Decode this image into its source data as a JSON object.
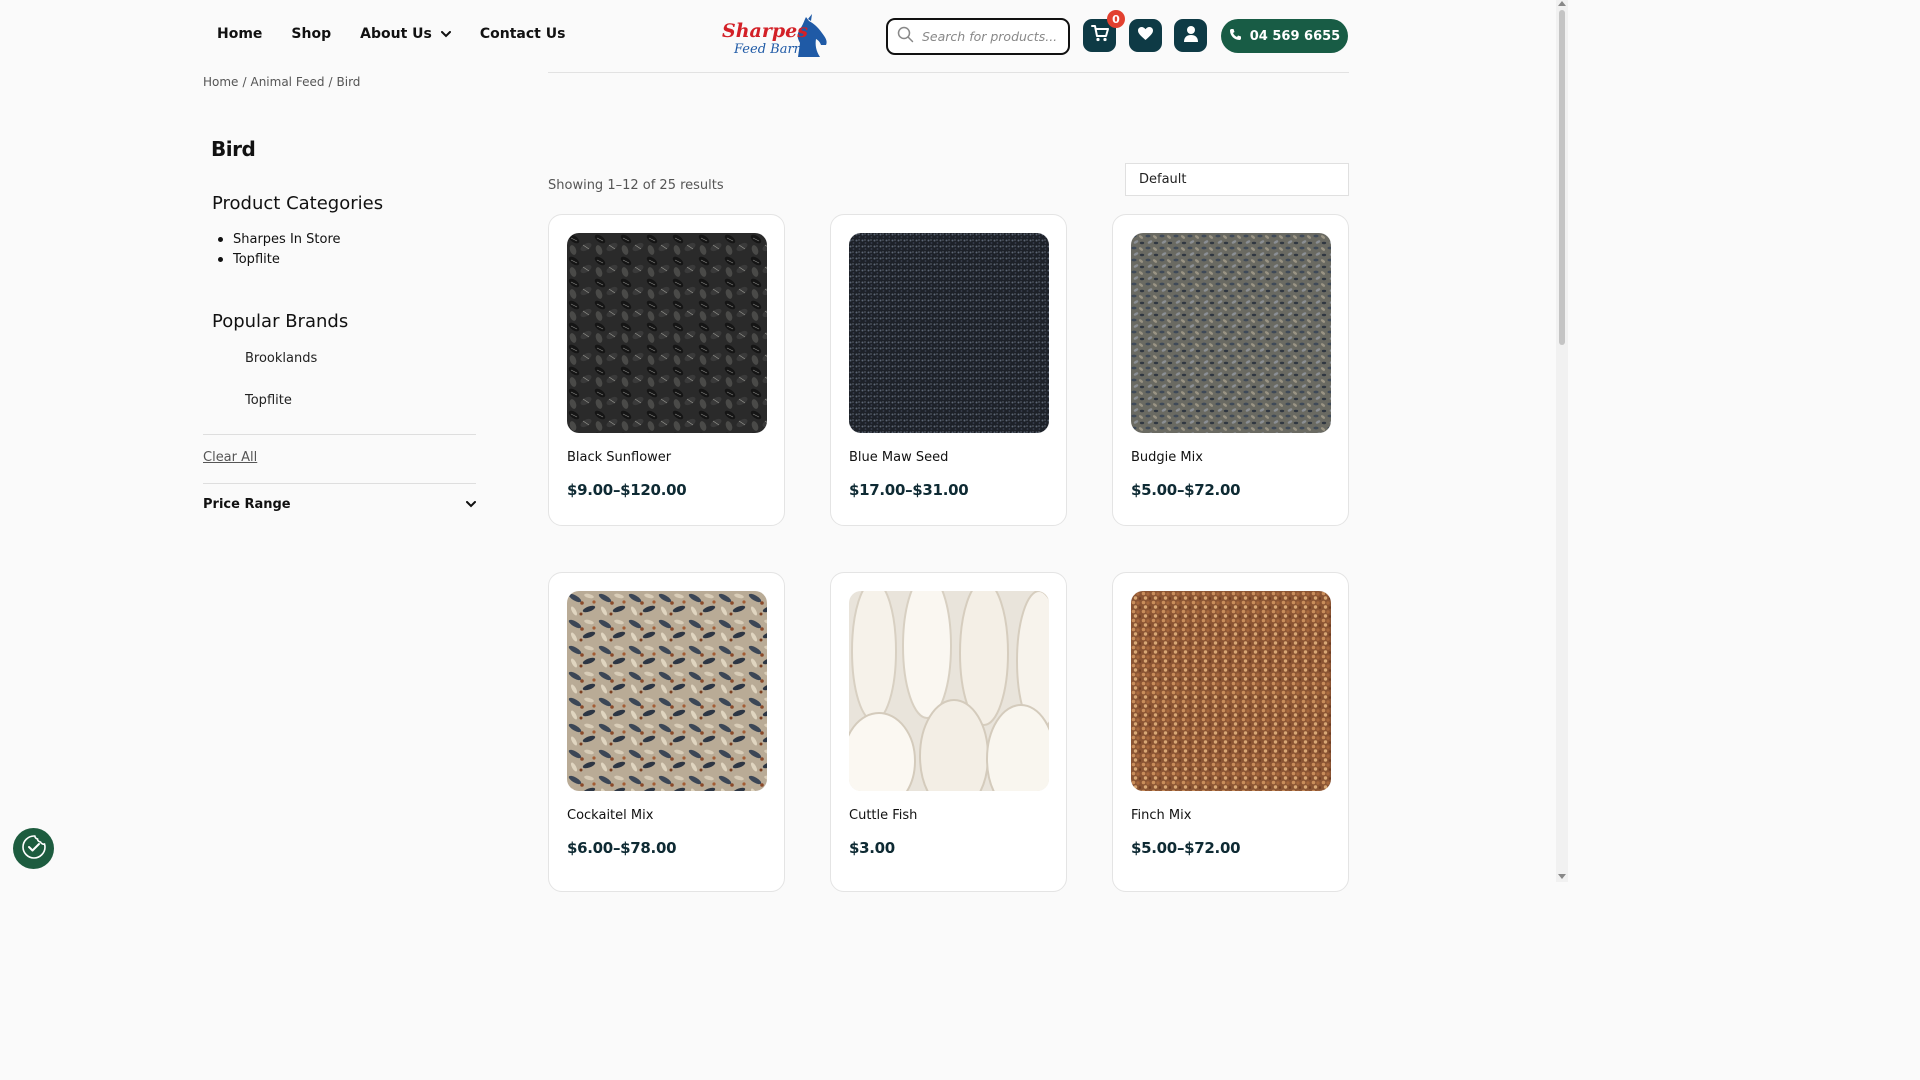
{
  "header": {
    "nav": [
      {
        "label": "Home"
      },
      {
        "label": "Shop"
      },
      {
        "label": "About Us"
      },
      {
        "label": "Contact Us"
      }
    ],
    "logo": {
      "line1": "Sharpes",
      "line2": "Feed Barn"
    },
    "search": {
      "placeholder": "Search for products..."
    },
    "cart_count": "0",
    "phone": "04 569 6655",
    "colors": {
      "dark": "#0e3a45",
      "phone_button": "#185c45",
      "badge": "#e2402f",
      "logo_red": "#d32027",
      "logo_blue": "#1f5aa6"
    }
  },
  "breadcrumb": [
    "Home",
    "Animal Feed",
    "Bird"
  ],
  "sidebar": {
    "page_title": "Bird",
    "categories_heading": "Product Categories",
    "categories": [
      "Sharpes In Store",
      "Topflite"
    ],
    "brands_heading": "Popular Brands",
    "brands": [
      "Brooklands",
      "Topflite"
    ],
    "clear_all": "Clear All",
    "price_range": "Price Range"
  },
  "results": {
    "count_text": "Showing 1–12 of 25 results",
    "sort_value": "Default"
  },
  "products": [
    {
      "name": "Black Sunflower",
      "price": "$9.00–$120.00"
    },
    {
      "name": "Blue Maw Seed",
      "price": "$17.00–$31.00"
    },
    {
      "name": "Budgie Mix",
      "price": "$5.00–$72.00"
    },
    {
      "name": "Cockaitel Mix",
      "price": "$6.00–$78.00"
    },
    {
      "name": "Cuttle Fish",
      "price": "$3.00"
    },
    {
      "name": "Finch Mix",
      "price": "$5.00–$72.00"
    }
  ]
}
